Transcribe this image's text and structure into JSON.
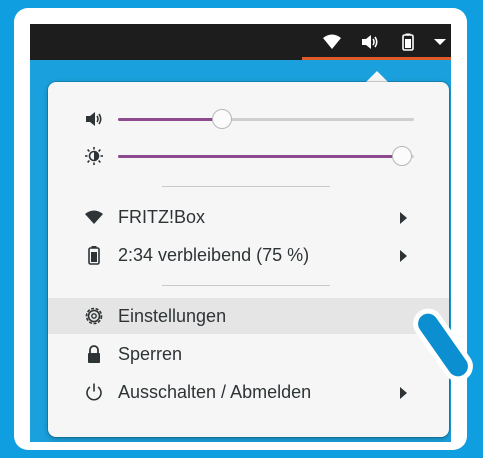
{
  "colors": {
    "desktop": "#1aa0dc",
    "topbar": "#1d1d1d",
    "accent_underline": "#e05a2a",
    "slider_fill": "#8e4a8f",
    "menu_bg": "#f6f6f6",
    "hover_bg": "#e5e5e5",
    "text": "#2e3436"
  },
  "topbar": {
    "icons": [
      "wifi-icon",
      "volume-icon",
      "battery-icon",
      "dropdown-arrow-icon"
    ]
  },
  "menu": {
    "volume_slider": {
      "icon": "volume-icon",
      "value": 0.35
    },
    "brightness_slider": {
      "icon": "brightness-icon",
      "value": 0.96
    },
    "items": [
      {
        "icon": "wifi-icon",
        "label": "FRITZ!Box",
        "submenu": true
      },
      {
        "icon": "battery-icon",
        "label": "2:34 verbleibend (75 %)",
        "submenu": true
      },
      {
        "icon": "settings-icon",
        "label": "Einstellungen",
        "submenu": false,
        "hovered": true
      },
      {
        "icon": "lock-icon",
        "label": "Sperren",
        "submenu": false
      },
      {
        "icon": "power-icon",
        "label": "Ausschalten / Abmelden",
        "submenu": true
      }
    ]
  }
}
